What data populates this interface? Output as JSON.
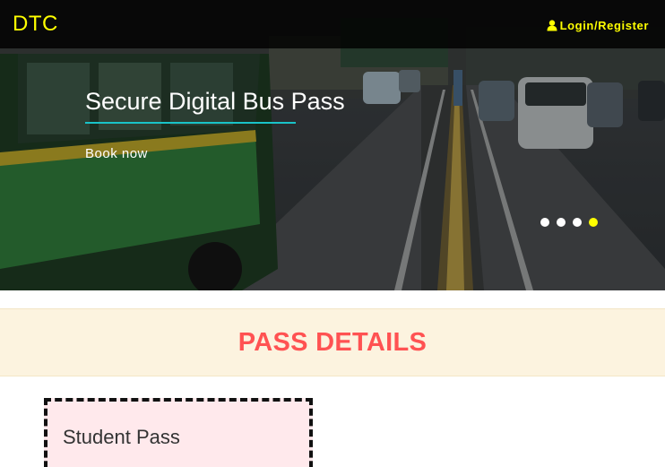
{
  "navbar": {
    "brand": "DTC",
    "login_label": "Login/Register",
    "icons": {
      "login": "user-icon"
    }
  },
  "hero": {
    "slide_title": "Secure Digital Bus Pass",
    "cta_label": "Book now",
    "indicators": {
      "count": 4,
      "active_index": 3
    }
  },
  "pass_details": {
    "heading": "PASS DETAILS",
    "cards": [
      {
        "title": "Student Pass"
      }
    ]
  },
  "colors": {
    "accent_yellow": "#ffff00",
    "heading_red": "#ff5252",
    "band_bg": "#fcf3df",
    "card_bg": "#ffe9ec",
    "underline_teal": "#19c3c8"
  }
}
